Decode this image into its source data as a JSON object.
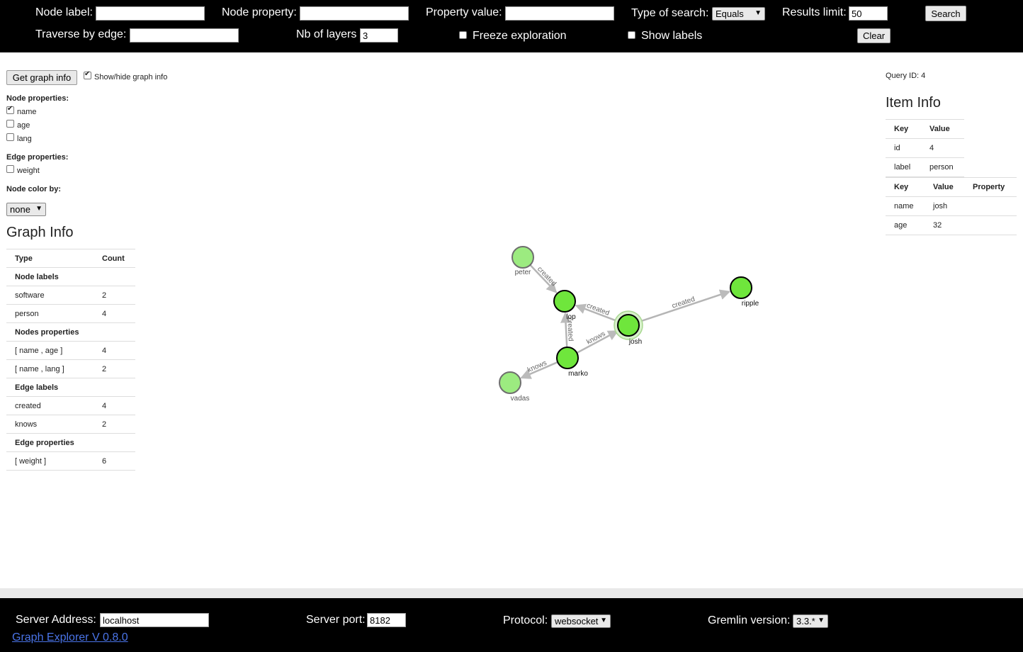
{
  "topbar": {
    "node_label": "Node label:",
    "node_property": "Node property:",
    "property_value": "Property value:",
    "type_of_search": "Type of search:",
    "type_of_search_value": "Equals",
    "results_limit": "Results limit:",
    "results_limit_value": "50",
    "search_button": "Search",
    "traverse_by_edge": "Traverse by edge:",
    "nb_of_layers": "Nb of layers",
    "nb_of_layers_value": "3",
    "freeze_exploration": "Freeze exploration",
    "show_labels": "Show labels",
    "clear_button": "Clear"
  },
  "left": {
    "get_graph_info": "Get graph info",
    "show_hide_graph_info": "Show/hide graph info",
    "node_properties_title": "Node properties:",
    "node_properties": [
      {
        "label": "name",
        "checked": true
      },
      {
        "label": "age",
        "checked": false
      },
      {
        "label": "lang",
        "checked": false
      }
    ],
    "edge_properties_title": "Edge properties:",
    "edge_properties": [
      {
        "label": "weight",
        "checked": false
      }
    ],
    "node_color_by": "Node color by:",
    "node_color_value": "none",
    "graph_info_title": "Graph Info",
    "graph_info_table": {
      "headers": [
        "Type",
        "Count"
      ],
      "rows": [
        {
          "type": "Node labels",
          "count": "",
          "header": true
        },
        {
          "type": "software",
          "count": "2"
        },
        {
          "type": "person",
          "count": "4"
        },
        {
          "type": "Nodes properties",
          "count": "",
          "header": true
        },
        {
          "type": "[ name , age ]",
          "count": "4"
        },
        {
          "type": "[ name , lang ]",
          "count": "2"
        },
        {
          "type": "Edge labels",
          "count": "",
          "header": true
        },
        {
          "type": "created",
          "count": "4"
        },
        {
          "type": "knows",
          "count": "2"
        },
        {
          "type": "Edge properties",
          "count": "",
          "header": true
        },
        {
          "type": "[ weight ]",
          "count": "6"
        }
      ]
    }
  },
  "right": {
    "query_id": "Query ID: 4",
    "item_info_title": "Item Info",
    "table1": {
      "headers": [
        "Key",
        "Value"
      ],
      "rows": [
        [
          "id",
          "4"
        ],
        [
          "label",
          "person"
        ]
      ]
    },
    "table2": {
      "headers": [
        "Key",
        "Value",
        "Property"
      ],
      "rows": [
        [
          "name",
          "josh",
          ""
        ],
        [
          "age",
          "32",
          ""
        ]
      ]
    }
  },
  "graph": {
    "node_color": "#6fe63c",
    "node_color_faded": "#8be86a",
    "nodes": [
      {
        "id": "peter",
        "label": "peter",
        "faded": true
      },
      {
        "id": "lop",
        "label": "lop",
        "faded": false
      },
      {
        "id": "josh",
        "label": "josh",
        "faded": false,
        "selected": true
      },
      {
        "id": "ripple",
        "label": "ripple",
        "faded": false
      },
      {
        "id": "marko",
        "label": "marko",
        "faded": false
      },
      {
        "id": "vadas",
        "label": "vadas",
        "faded": true
      }
    ],
    "edges": [
      {
        "source": "peter",
        "target": "lop",
        "label": "created"
      },
      {
        "source": "josh",
        "target": "lop",
        "label": "created"
      },
      {
        "source": "marko",
        "target": "lop",
        "label": "created"
      },
      {
        "source": "josh",
        "target": "ripple",
        "label": "created"
      },
      {
        "source": "marko",
        "target": "josh",
        "label": "knows"
      },
      {
        "source": "marko",
        "target": "vadas",
        "label": "knows"
      }
    ]
  },
  "footer": {
    "server_address": "Server Address:",
    "server_address_value": "localhost",
    "server_port": "Server port:",
    "server_port_value": "8182",
    "protocol": "Protocol:",
    "protocol_value": "websocket",
    "gremlin_version": "Gremlin version:",
    "gremlin_version_value": "3.3.*",
    "app_link": "Graph Explorer V 0.8.0"
  }
}
